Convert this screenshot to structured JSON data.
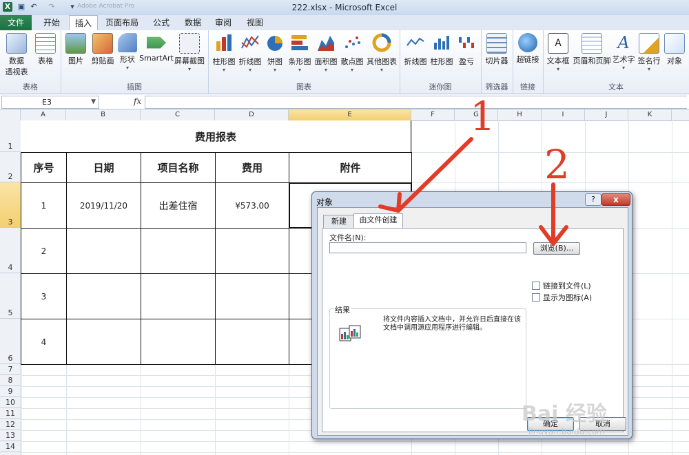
{
  "window": {
    "title": "222.xlsx - Microsoft Excel",
    "faded_title": "Adobe Acrobat Pro"
  },
  "tabs": [
    {
      "label": "文件"
    },
    {
      "label": "开始"
    },
    {
      "label": "插入"
    },
    {
      "label": "页面布局"
    },
    {
      "label": "公式"
    },
    {
      "label": "数据"
    },
    {
      "label": "审阅"
    },
    {
      "label": "视图"
    }
  ],
  "ribbon": {
    "groups": {
      "table": "表格",
      "illustrations": "插图",
      "charts": "图表",
      "sparklines": "迷你图",
      "filter": "筛选器",
      "links": "链接",
      "text": "文本"
    },
    "buttons": {
      "pivot": "数据",
      "pivot2": "透视表",
      "table": "表格",
      "picture": "图片",
      "clipart": "剪贴画",
      "shapes": "形状",
      "smartart": "SmartArt",
      "screenshot": "屏幕截图",
      "col_chart": "柱形图",
      "line_chart": "折线图",
      "pie_chart": "饼图",
      "bar_chart": "条形图",
      "area_chart": "面积图",
      "scatter_chart": "散点图",
      "other_chart": "其他图表",
      "spark_line": "折线图",
      "spark_col": "柱形图",
      "spark_wl": "盈亏",
      "slicer": "切片器",
      "hyperlink": "超链接",
      "textbox": "文本框",
      "header_footer": "页眉和页脚",
      "wordart": "艺术字",
      "signature": "签名行",
      "object": "对象"
    }
  },
  "formula_bar": {
    "name_box": "E3",
    "fx": "fx",
    "value": ""
  },
  "columns": [
    "A",
    "B",
    "C",
    "D",
    "E",
    "F",
    "G",
    "H",
    "I",
    "J",
    "K"
  ],
  "rows": [
    "1",
    "2",
    "3",
    "4",
    "5",
    "6",
    "7",
    "8",
    "9",
    "10",
    "11",
    "12",
    "13",
    "14"
  ],
  "sheet": {
    "title": "费用报表",
    "headers": [
      "序号",
      "日期",
      "项目名称",
      "费用",
      "附件"
    ],
    "rows": [
      {
        "no": "1",
        "date": "2019/11/20",
        "item": "出差住宿",
        "cost": "¥573.00",
        "attach": ""
      },
      {
        "no": "2",
        "date": "",
        "item": "",
        "cost": "",
        "attach": ""
      },
      {
        "no": "3",
        "date": "",
        "item": "",
        "cost": "",
        "attach": ""
      },
      {
        "no": "4",
        "date": "",
        "item": "",
        "cost": "",
        "attach": ""
      }
    ]
  },
  "dialog": {
    "title": "对象",
    "help": "?",
    "close": "x",
    "tab_new": "新建",
    "tab_fromfile": "由文件创建",
    "filename_label": "文件名(N):",
    "filename_value": "",
    "browse": "浏览(B)...",
    "link_to_file": "链接到文件(L)",
    "display_as_icon": "显示为图标(A)",
    "result_label": "结果",
    "result_text": "将文件内容插入文档中，并允许日后直接在该文档中调用源应用程序进行编辑。",
    "ok": "确定",
    "cancel": "取消"
  },
  "annotations": {
    "one": "1",
    "two": "2"
  },
  "watermark": {
    "main": "Bai 经验",
    "sub": "jingyan.baidu.com"
  },
  "colors": {
    "annotation": "#e23b26",
    "excel_green": "#1f6f43",
    "selection": "#f3cf70"
  }
}
